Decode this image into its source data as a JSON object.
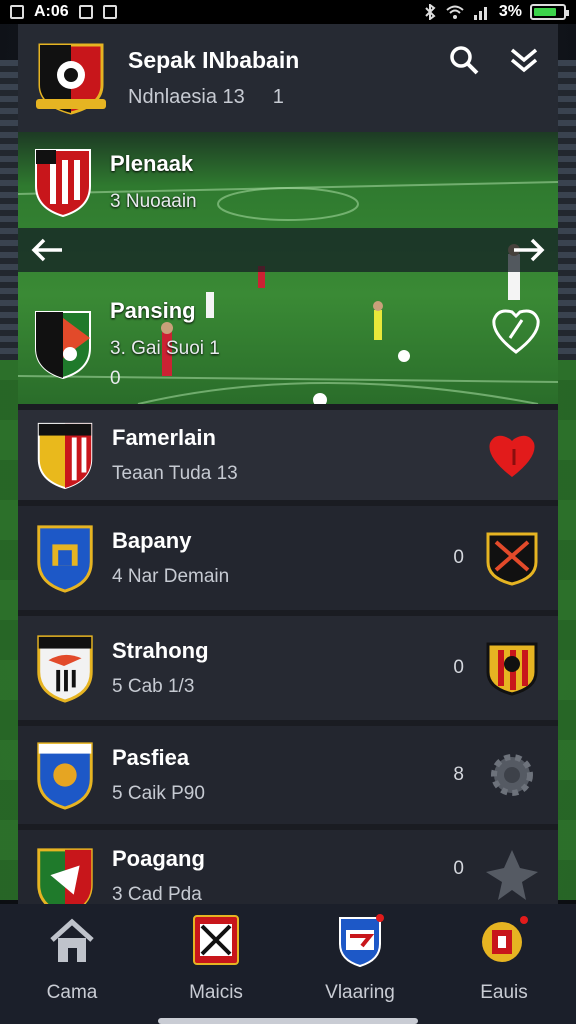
{
  "status_bar": {
    "time": "A:06",
    "battery": "3%"
  },
  "header": {
    "title": "Sepak INbabain",
    "subtitle": "Ndnlaesia 13",
    "subtitle_count": "1"
  },
  "banner": {
    "match1": {
      "name": "Plenaak",
      "meta": "3  Nuoaain"
    },
    "match2": {
      "name": "Pansing",
      "meta": "3. Gai Suoi  1",
      "meta2": "0"
    }
  },
  "list": [
    {
      "name": "Famerlain",
      "meta": "Teaan Tuda 13",
      "score": ""
    },
    {
      "name": "Bapany",
      "meta": "4  Nar Demain",
      "score": "0"
    },
    {
      "name": "Strahong",
      "meta": "5  Cab 1/3",
      "score": "0"
    },
    {
      "name": "Pasfiea",
      "meta": "5  Caik P90",
      "score": "8"
    },
    {
      "name": "Poagang",
      "meta": "3  Cad Pda",
      "score": "0"
    }
  ],
  "bottom_nav": [
    {
      "label": "Cama",
      "icon": "home-icon"
    },
    {
      "label": "Maicis",
      "icon": "matches-icon"
    },
    {
      "label": "Vlaaring",
      "icon": "team-badge-icon"
    },
    {
      "label": "Eauis",
      "icon": "profile-badge-icon"
    }
  ],
  "colors": {
    "accent_red": "#e21b1b",
    "pitch_green": "#2f7a2c",
    "panel": "#23262f",
    "battery_green": "#3cd34a"
  }
}
